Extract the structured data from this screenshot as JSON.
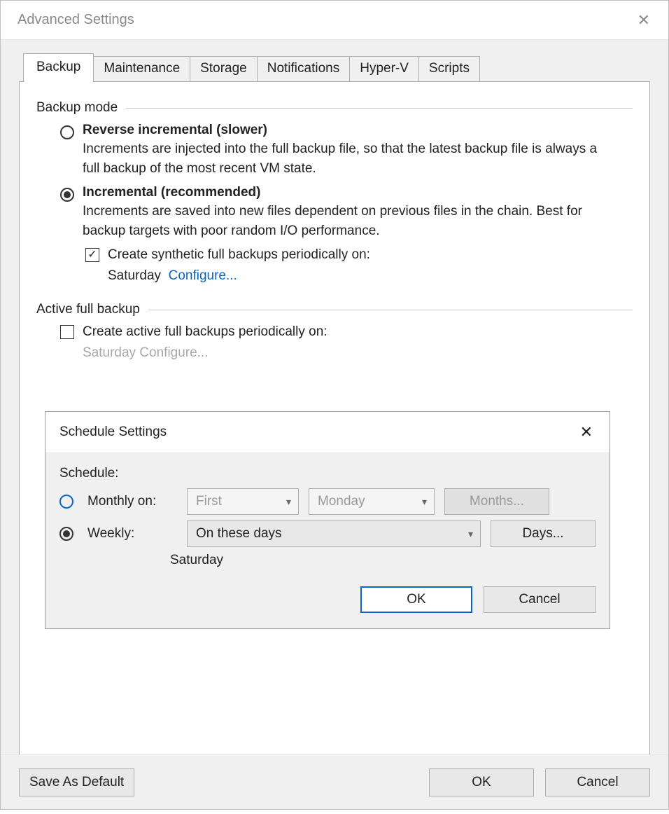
{
  "window": {
    "title": "Advanced Settings"
  },
  "tabs": {
    "items": [
      "Backup",
      "Maintenance",
      "Storage",
      "Notifications",
      "Hyper-V",
      "Scripts"
    ],
    "active": 0
  },
  "backup_mode": {
    "legend": "Backup mode",
    "reverse": {
      "title": "Reverse incremental (slower)",
      "desc": "Increments are injected into the full backup file, so that the latest backup file is always a full backup of the most recent VM state.",
      "selected": false
    },
    "incremental": {
      "title": "Incremental (recommended)",
      "desc": "Increments are saved into new files dependent on previous files in the chain. Best for backup targets with poor random I/O performance.",
      "selected": true,
      "synthetic_checkbox_label": "Create synthetic full backups periodically on:",
      "synthetic_checked": true,
      "synthetic_day": "Saturday",
      "configure_link": "Configure..."
    }
  },
  "active_full": {
    "legend": "Active full backup",
    "checkbox_label": "Create active full backups periodically on:",
    "checked": false,
    "day": "Saturday",
    "configure_link": "Configure..."
  },
  "schedule_dialog": {
    "title": "Schedule Settings",
    "schedule_label": "Schedule:",
    "monthly": {
      "label": "Monthly on:",
      "selected": false,
      "ordinal": "First",
      "day": "Monday",
      "months_button": "Months..."
    },
    "weekly": {
      "label": "Weekly:",
      "selected": true,
      "combo_text": "On these days",
      "days_button": "Days...",
      "selected_day": "Saturday"
    },
    "ok": "OK",
    "cancel": "Cancel"
  },
  "bottom": {
    "save_default": "Save As Default",
    "ok": "OK",
    "cancel": "Cancel"
  }
}
